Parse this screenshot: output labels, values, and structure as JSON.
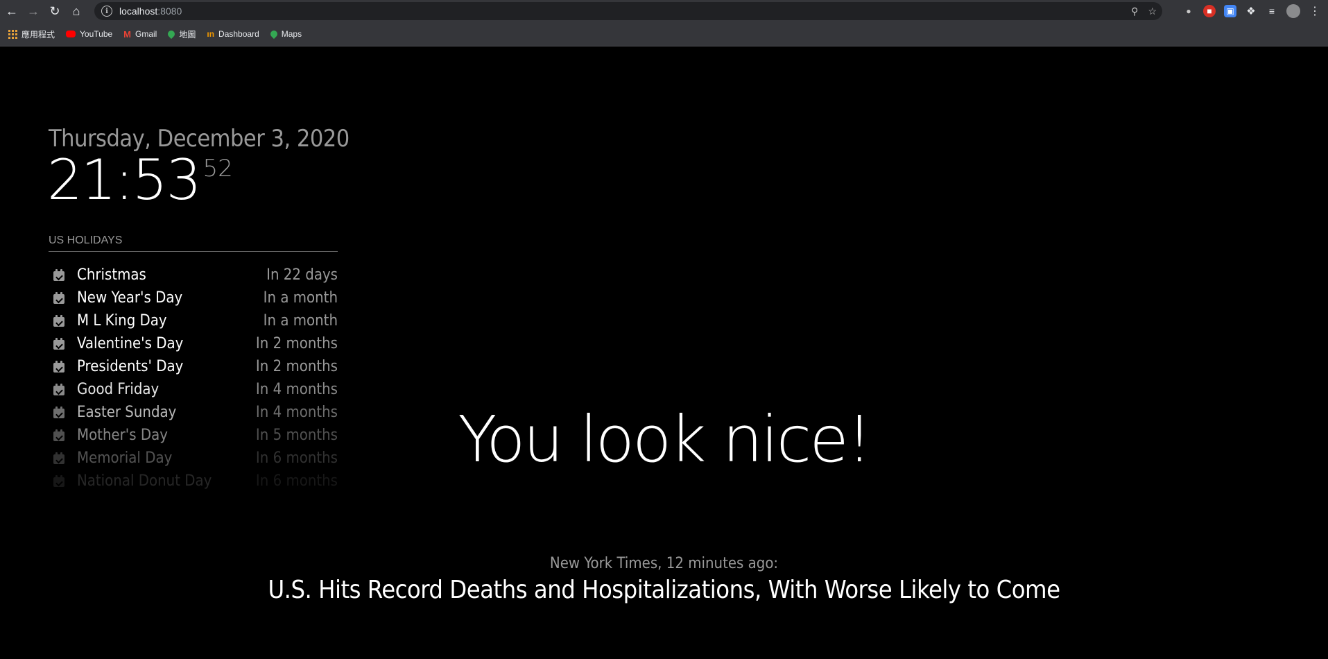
{
  "browser": {
    "url_host": "localhost",
    "url_port": ":8080",
    "bookmarks": [
      {
        "label": "應用程式",
        "icon": "apps-grid-icon"
      },
      {
        "label": "YouTube",
        "icon": "youtube-icon",
        "color": "#ff0000"
      },
      {
        "label": "Gmail",
        "icon": "gmail-icon",
        "color": "#ea4335"
      },
      {
        "label": "地圖",
        "icon": "maps-pin-icon",
        "color": "#34a853"
      },
      {
        "label": "Dashboard",
        "icon": "dashboard-icon",
        "color": "#f29900"
      },
      {
        "label": "Maps",
        "icon": "maps-pin-icon",
        "color": "#34a853"
      }
    ]
  },
  "clock": {
    "date": "Thursday, December 3, 2020",
    "time": "21:53",
    "seconds": "52"
  },
  "holidays": {
    "header": "US HOLIDAYS",
    "items": [
      {
        "name": "Christmas",
        "time": "In 22 days",
        "opacity": 1.0
      },
      {
        "name": "New Year's Day",
        "time": "In a month",
        "opacity": 1.0
      },
      {
        "name": "M L King Day",
        "time": "In a month",
        "opacity": 1.0
      },
      {
        "name": "Valentine's Day",
        "time": "In 2 months",
        "opacity": 1.0
      },
      {
        "name": "Presidents' Day",
        "time": "In 2 months",
        "opacity": 1.0
      },
      {
        "name": "Good Friday",
        "time": "In 4 months",
        "opacity": 0.9
      },
      {
        "name": "Easter Sunday",
        "time": "In 4 months",
        "opacity": 0.72
      },
      {
        "name": "Mother's Day",
        "time": "In 5 months",
        "opacity": 0.52
      },
      {
        "name": "Memorial Day",
        "time": "In 6 months",
        "opacity": 0.32
      },
      {
        "name": "National Donut Day",
        "time": "In 6 months",
        "opacity": 0.15
      }
    ]
  },
  "compliment": "You look nice!",
  "news": {
    "source": "New York Times, 12 minutes ago:",
    "title": "U.S. Hits Record Deaths and Hospitalizations, With Worse Likely to Come"
  }
}
